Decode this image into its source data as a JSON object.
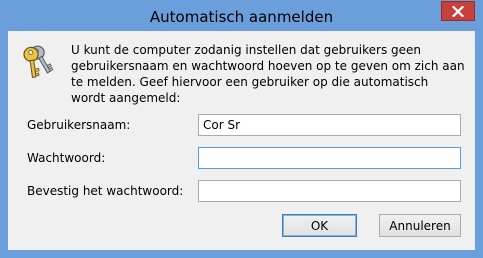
{
  "window": {
    "title": "Automatisch aanmelden",
    "close_icon": "close-icon",
    "frame_color": "#6b9fdc",
    "close_color": "#c7413b"
  },
  "intro": {
    "icon": "keys-icon",
    "text": "U kunt de computer zodanig instellen dat gebruikers geen gebruikersnaam en wachtwoord hoeven op te geven om zich aan te melden. Geef hiervoor een gebruiker op die automatisch wordt aangemeld:"
  },
  "form": {
    "username_label": "Gebruikersnaam:",
    "username_value": "Cor Sr",
    "password_label": "Wachtwoord:",
    "password_value": "",
    "confirm_label": "Bevestig het wachtwoord:",
    "confirm_value": ""
  },
  "buttons": {
    "ok_label": "OK",
    "cancel_label": "Annuleren"
  }
}
